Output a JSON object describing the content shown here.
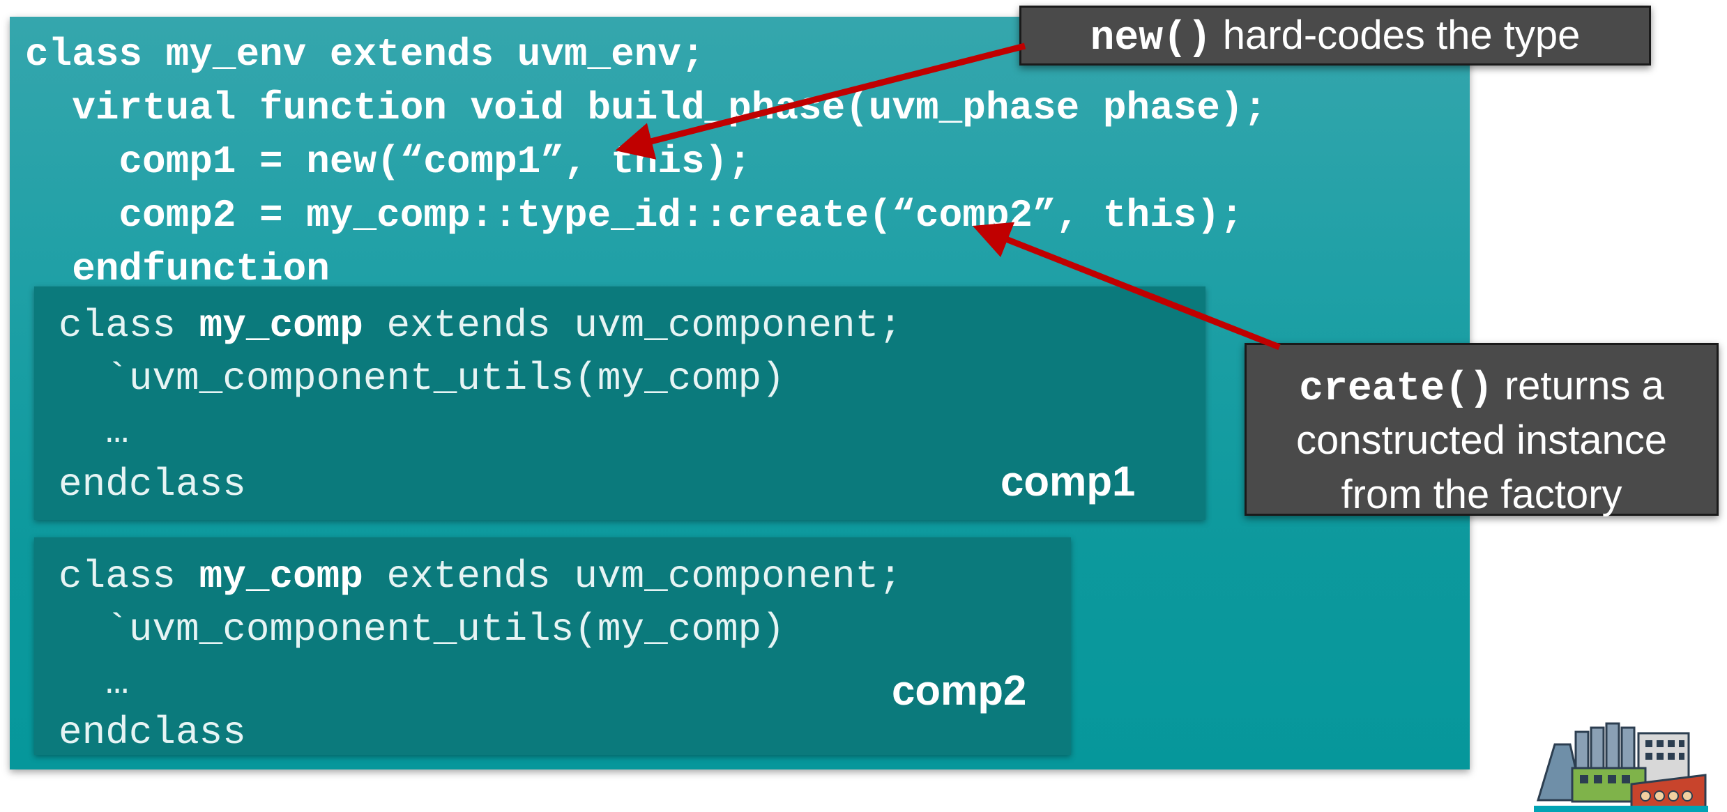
{
  "env_code": {
    "line1": "class my_env extends uvm_env;",
    "line2": "  virtual function void build_phase(uvm_phase phase);",
    "line3": "    comp1 = new(“comp1”, this);",
    "line4": "    comp2 = my_comp::type_id::create(“comp2”, this);",
    "line5": "  endfunction"
  },
  "comp1_box": {
    "kw_class": "class ",
    "name": "my_comp",
    "rest": " extends uvm_component;",
    "macro": "  `uvm_component_utils(my_comp)",
    "ellipsis": "  …",
    "end": "endclass",
    "label": "comp1"
  },
  "comp2_box": {
    "kw_class": "class ",
    "name": "my_comp",
    "rest": " extends uvm_component;",
    "macro": "  `uvm_component_utils(my_comp)",
    "ellipsis": "  …",
    "end": "endclass",
    "label": "comp2"
  },
  "callout_new": {
    "code": "new()",
    "text": " hard-codes the type"
  },
  "callout_create": {
    "code": "create()",
    "text1": " returns a",
    "text2": "constructed instance",
    "text3": "from the factory"
  },
  "colors": {
    "panel": "#1fa0a6",
    "code_box": "#0b7a7c",
    "callout": "#4a4a4a",
    "arrow": "#c00000"
  },
  "icons": [
    "factory-icon"
  ]
}
